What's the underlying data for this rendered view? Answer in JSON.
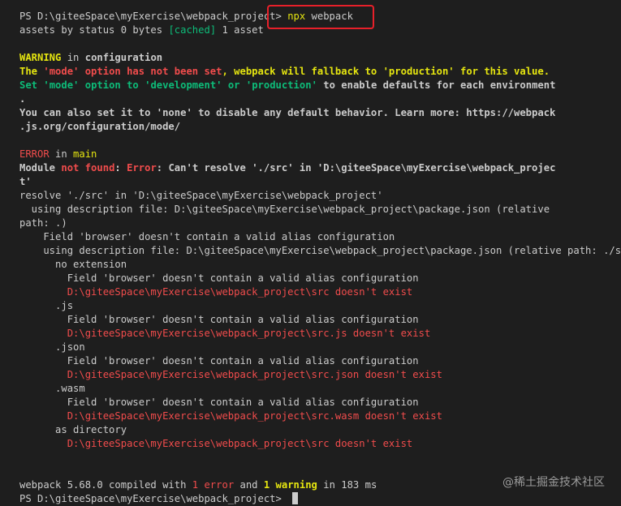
{
  "terminal": {
    "lines": [
      [
        {
          "t": "PS D:\\giteeSpace\\myExercise\\webpack_project> ",
          "c": "w"
        },
        {
          "t": "npx",
          "c": "y"
        },
        {
          "t": " webpack",
          "c": "w"
        }
      ],
      [
        {
          "t": "assets by status 0 bytes ",
          "c": "w"
        },
        {
          "t": "[cached]",
          "c": "g"
        },
        {
          "t": " 1 asset",
          "c": "w"
        }
      ],
      [],
      [
        {
          "t": "WARNING",
          "c": "y b"
        },
        {
          "t": " in ",
          "c": "w"
        },
        {
          "t": "configuration",
          "c": "w b"
        }
      ],
      [
        {
          "t": "The ",
          "c": "y b"
        },
        {
          "t": "'mode' option has not been set",
          "c": "r b"
        },
        {
          "t": ", webpack will fallback to 'production' for this value.",
          "c": "y b"
        }
      ],
      [
        {
          "t": "Set ",
          "c": "g b"
        },
        {
          "t": "'mode'",
          "c": "g b"
        },
        {
          "t": " option to ",
          "c": "g b"
        },
        {
          "t": "'development'",
          "c": "g b"
        },
        {
          "t": " or ",
          "c": "g b"
        },
        {
          "t": "'production'",
          "c": "g b"
        },
        {
          "t": " to enable defaults for each environment",
          "c": "w b"
        }
      ],
      [
        {
          "t": ".",
          "c": "w b"
        }
      ],
      [
        {
          "t": "You can also set it to 'none' to disable any default behavior. Learn more: https://webpack",
          "c": "w b"
        }
      ],
      [
        {
          "t": ".js.org/configuration/mode/",
          "c": "w b"
        }
      ],
      [],
      [
        {
          "t": "ERROR",
          "c": "r"
        },
        {
          "t": " in ",
          "c": "w"
        },
        {
          "t": "main",
          "c": "y"
        }
      ],
      [
        {
          "t": "Module ",
          "c": "w b"
        },
        {
          "t": "not found",
          "c": "r b"
        },
        {
          "t": ": ",
          "c": "w b"
        },
        {
          "t": "Error",
          "c": "r b"
        },
        {
          "t": ": Can't resolve './src' in 'D:\\giteeSpace\\myExercise\\webpack_projec",
          "c": "w b"
        }
      ],
      [
        {
          "t": "t'",
          "c": "w b"
        }
      ],
      [
        {
          "t": "resolve './src' in 'D:\\giteeSpace\\myExercise\\webpack_project'",
          "c": "w"
        }
      ],
      [
        {
          "t": "  using description file: D:\\giteeSpace\\myExercise\\webpack_project\\package.json (relative",
          "c": "w"
        }
      ],
      [
        {
          "t": "path: .)",
          "c": "w"
        }
      ],
      [
        {
          "t": "    Field 'browser' doesn't contain a valid alias configuration",
          "c": "w"
        }
      ],
      [
        {
          "t": "    using description file: D:\\giteeSpace\\myExercise\\webpack_project\\package.json (relative path: ./src)",
          "c": "w"
        }
      ],
      [
        {
          "t": "      no extension",
          "c": "w"
        }
      ],
      [
        {
          "t": "        Field 'browser' doesn't contain a valid alias configuration",
          "c": "w"
        }
      ],
      [
        {
          "t": "        D:\\giteeSpace\\myExercise\\webpack_project\\src doesn't exist",
          "c": "r"
        }
      ],
      [
        {
          "t": "      .js",
          "c": "w"
        }
      ],
      [
        {
          "t": "        Field 'browser' doesn't contain a valid alias configuration",
          "c": "w"
        }
      ],
      [
        {
          "t": "        D:\\giteeSpace\\myExercise\\webpack_project\\src.js doesn't exist",
          "c": "r"
        }
      ],
      [
        {
          "t": "      .json",
          "c": "w"
        }
      ],
      [
        {
          "t": "        Field 'browser' doesn't contain a valid alias configuration",
          "c": "w"
        }
      ],
      [
        {
          "t": "        D:\\giteeSpace\\myExercise\\webpack_project\\src.json doesn't exist",
          "c": "r"
        }
      ],
      [
        {
          "t": "      .wasm",
          "c": "w"
        }
      ],
      [
        {
          "t": "        Field 'browser' doesn't contain a valid alias configuration",
          "c": "w"
        }
      ],
      [
        {
          "t": "        D:\\giteeSpace\\myExercise\\webpack_project\\src.wasm doesn't exist",
          "c": "r"
        }
      ],
      [
        {
          "t": "      as directory",
          "c": "w"
        }
      ],
      [
        {
          "t": "        D:\\giteeSpace\\myExercise\\webpack_project\\src doesn't exist",
          "c": "r"
        }
      ],
      [],
      [],
      [
        {
          "t": "webpack 5.68.0 compiled with ",
          "c": "w"
        },
        {
          "t": "1 error",
          "c": "r"
        },
        {
          "t": " and ",
          "c": "w"
        },
        {
          "t": "1 warning",
          "c": "y b"
        },
        {
          "t": " in 183 ms",
          "c": "w"
        }
      ],
      [
        {
          "t": "PS D:\\giteeSpace\\myExercise\\webpack_project> ",
          "c": "w"
        }
      ]
    ]
  },
  "watermark": "@稀土掘金技术社区",
  "colors": {
    "background": "#1e1e1e",
    "text": "#cccccc",
    "yellow": "#e5e510",
    "green": "#0dbc79",
    "red": "#f14c4c",
    "highlight_box": "#e8202a"
  }
}
